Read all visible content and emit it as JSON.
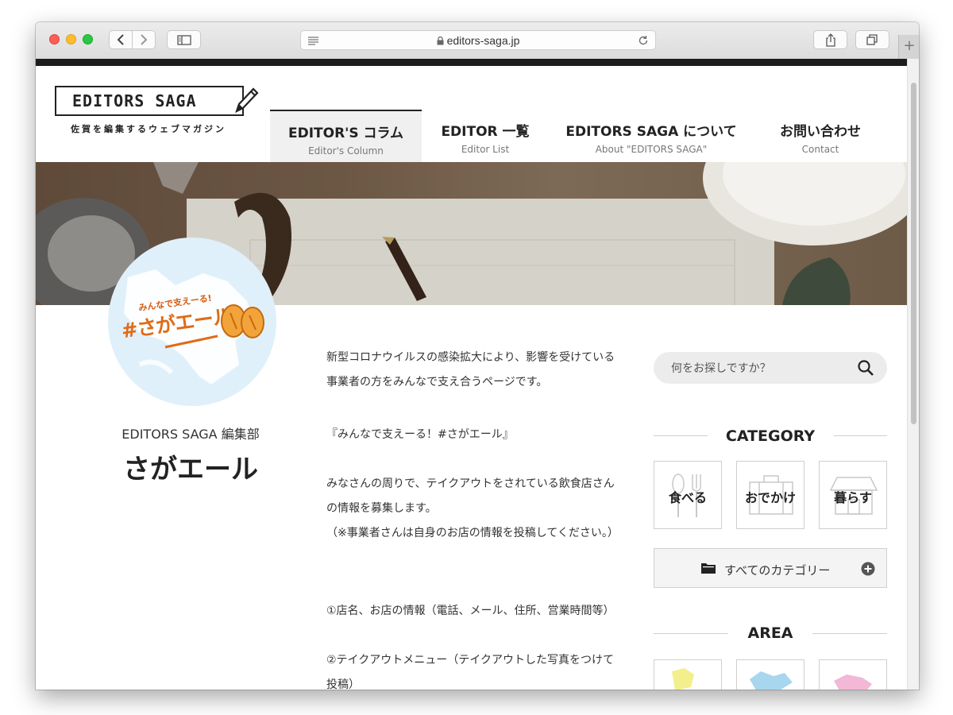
{
  "browser": {
    "url": "editors-saga.jp"
  },
  "site": {
    "logo_text": "EDITORS SAGA",
    "logo_tagline": "佐賀を編集するウェブマガジン",
    "nav": [
      {
        "jp": "EDITOR'S コラム",
        "en": "Editor's Column"
      },
      {
        "jp": "EDITOR 一覧",
        "en": "Editor List"
      },
      {
        "jp": "EDITORS SAGA について",
        "en": "About \"EDITORS SAGA\""
      },
      {
        "jp": "お問い合わせ",
        "en": "Contact"
      }
    ]
  },
  "article": {
    "avatar_text_small": "みんなで支えーる!",
    "avatar_text_big": "#さがエール!",
    "author": "EDITORS SAGA 編集部",
    "title": "さがエール",
    "paragraphs": [
      "新型コロナウイルスの感染拡大により、影響を受けている事業者の方をみんなで支え合うページです。",
      "『みんなで支えーる！#さがエール』",
      "みなさんの周りで、テイクアウトをされている飲食店さんの情報を募集します。",
      "（※事業者さんは自身のお店の情報を投稿してください。）",
      "①店名、お店の情報（電話、メール、住所、営業時間等）",
      "②テイクアウトメニュー（テイクアウトした写真をつけて投稿）"
    ]
  },
  "sidebar": {
    "search_placeholder": "何をお探しですか？",
    "category_title": "CATEGORY",
    "categories": [
      "食べる",
      "おでかけ",
      "暮らす"
    ],
    "all_categories": "すべてのカテゴリー",
    "area_title": "AREA"
  }
}
